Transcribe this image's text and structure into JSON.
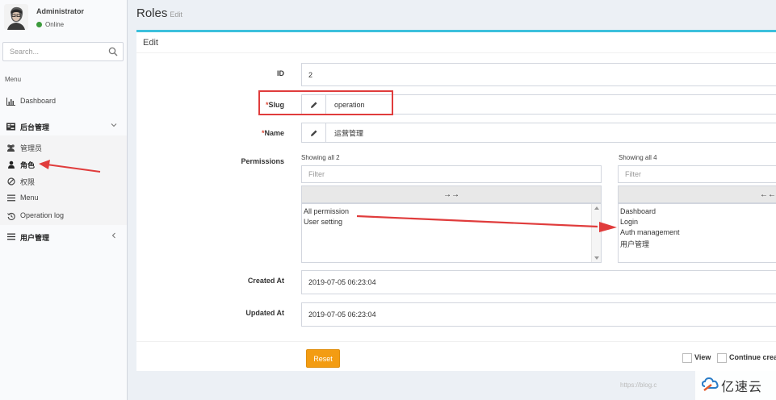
{
  "sidebar": {
    "user_name": "Administrator",
    "user_status": "Online",
    "search_placeholder": "Search...",
    "menu_header": "Menu",
    "items": [
      {
        "label": "Dashboard",
        "icon": "bar-chart-icon"
      },
      {
        "label": "后台管理",
        "icon": "tasks-icon"
      },
      {
        "label": "管理员",
        "icon": "users-icon"
      },
      {
        "label": "角色",
        "icon": "user-icon"
      },
      {
        "label": "权限",
        "icon": "ban-icon"
      },
      {
        "label": "Menu",
        "icon": "bars-icon"
      },
      {
        "label": "Operation log",
        "icon": "history-icon"
      },
      {
        "label": "用户管理",
        "icon": "bars-icon"
      }
    ]
  },
  "header": {
    "title": "Roles",
    "subtitle": "Edit"
  },
  "form": {
    "box_title": "Edit",
    "id_label": "ID",
    "id_value": "2",
    "slug_label": "Slug",
    "slug_value": "operation",
    "name_label": "Name",
    "name_value": "运营管理",
    "required_mark": "*",
    "permissions_label": "Permissions",
    "left_showing": "Showing all 2",
    "right_showing": "Showing all 4",
    "filter_placeholder": "Filter",
    "move_right_label": "→→",
    "move_left_label": "←←",
    "left_options": [
      "All permission",
      "User setting"
    ],
    "right_options": [
      "Dashboard",
      "Login",
      "Auth management",
      "用户管理"
    ],
    "created_label": "Created At",
    "created_value": "2019-07-05 06:23:04",
    "updated_label": "Updated At",
    "updated_value": "2019-07-05 06:23:04"
  },
  "footer": {
    "reset_label": "Reset",
    "view_label": "View",
    "continue_label": "Continue crea"
  },
  "watermark": {
    "url": "https://blog.c",
    "logo_text": "亿速云"
  },
  "colors": {
    "accent_top": "#3cc0dc",
    "reset_button": "#f39c12",
    "annotation_red": "#e03c3c",
    "status_online": "#3c9a3c"
  }
}
